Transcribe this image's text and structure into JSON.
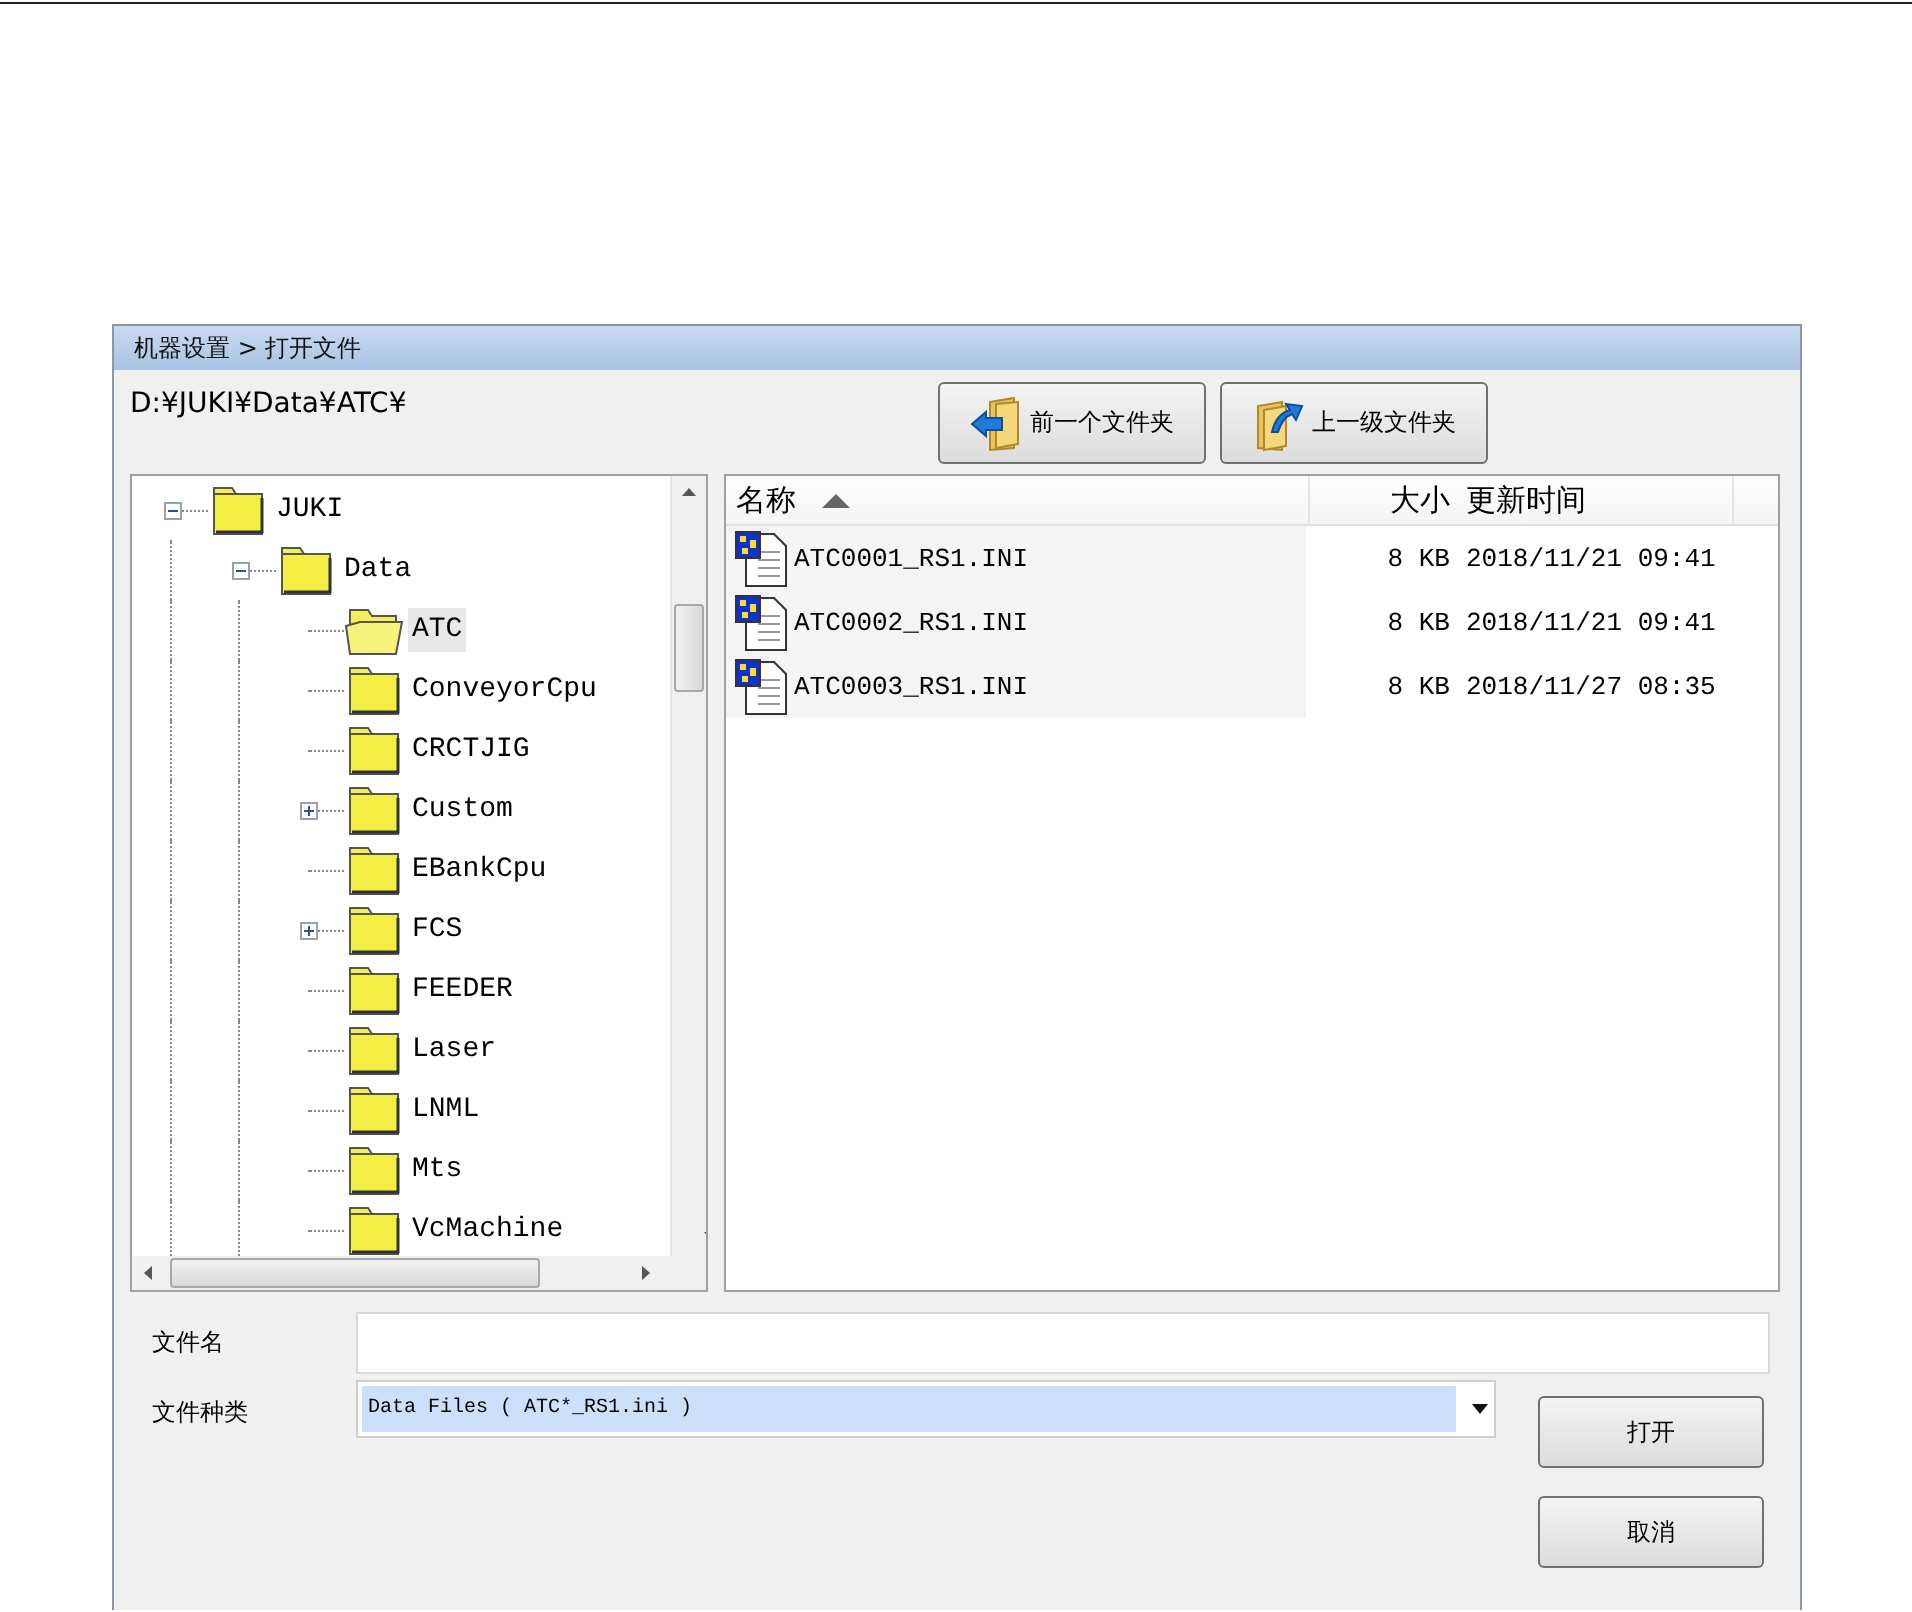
{
  "dialog": {
    "title": "机器设置 > 打开文件",
    "path": "D:¥JUKI¥Data¥ATC¥"
  },
  "nav_buttons": [
    {
      "label": "前一个文件夹",
      "kind": "back"
    },
    {
      "label": "上一级文件夹",
      "kind": "up"
    }
  ],
  "tree": [
    {
      "label": "JUKI",
      "expanded": true,
      "selected": false,
      "children": [
        {
          "label": "Data",
          "expanded": true,
          "selected": false,
          "children": [
            {
              "label": "ATC",
              "selected": true
            },
            {
              "label": "ConveyorCpu",
              "selected": false
            },
            {
              "label": "CRCTJIG",
              "selected": false
            },
            {
              "label": "Custom",
              "expanded": false,
              "selected": false
            },
            {
              "label": "EBankCpu",
              "selected": false
            },
            {
              "label": "FCS",
              "expanded": false,
              "selected": false
            },
            {
              "label": "FEEDER",
              "selected": false
            },
            {
              "label": "Laser",
              "selected": false
            },
            {
              "label": "LNML",
              "selected": false
            },
            {
              "label": "Mts",
              "selected": false
            },
            {
              "label": "VcMachine",
              "selected": false
            }
          ]
        }
      ]
    }
  ],
  "file_list": {
    "columns": [
      {
        "label": "名称",
        "sorted_ascending": true
      },
      {
        "label": "大小"
      },
      {
        "label": "更新时间"
      }
    ],
    "rows": [
      {
        "name": "ATC0001_RS1.INI",
        "size": "8 KB",
        "modified": "2018/11/21 09:41"
      },
      {
        "name": "ATC0002_RS1.INI",
        "size": "8 KB",
        "modified": "2018/11/21 09:41"
      },
      {
        "name": "ATC0003_RS1.INI",
        "size": "8 KB",
        "modified": "2018/11/27 08:35"
      }
    ]
  },
  "filename": {
    "label": "文件名"
  },
  "filetype": {
    "label": "文件种类",
    "value": "Data Files ( ATC*_RS1.ini )"
  },
  "buttons": [
    {
      "label": "打开"
    },
    {
      "label": "取消"
    }
  ]
}
